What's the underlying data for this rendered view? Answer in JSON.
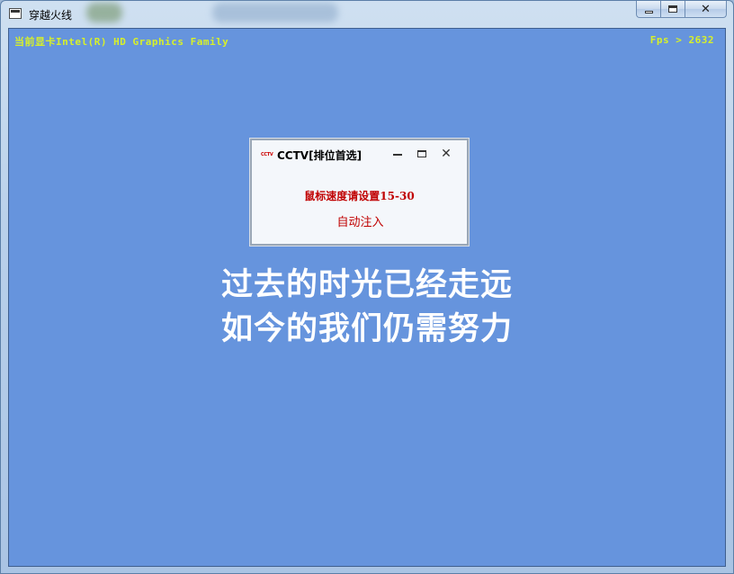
{
  "window": {
    "title": "穿越火线",
    "icon": "app-window-icon",
    "controls": [
      "minimize-icon",
      "maximize-icon",
      "close-icon"
    ]
  },
  "hud": {
    "gpu_text": "当前显卡Intel(R) HD Graphics Family",
    "fps_text": "Fps > 2632",
    "color": "#d7f02a"
  },
  "dialog": {
    "logo_text": "CCTV",
    "title": "CCTV[排位首选]",
    "hint": "鼠标速度请设置15-30",
    "button_label": "自动注入",
    "accent": "#c00000"
  },
  "slogan": {
    "line1": "过去的时光已经走远",
    "line2": "如今的我们仍需努力"
  },
  "colors": {
    "client_bg": "#6694dd",
    "frame": "#b9d0ea"
  }
}
